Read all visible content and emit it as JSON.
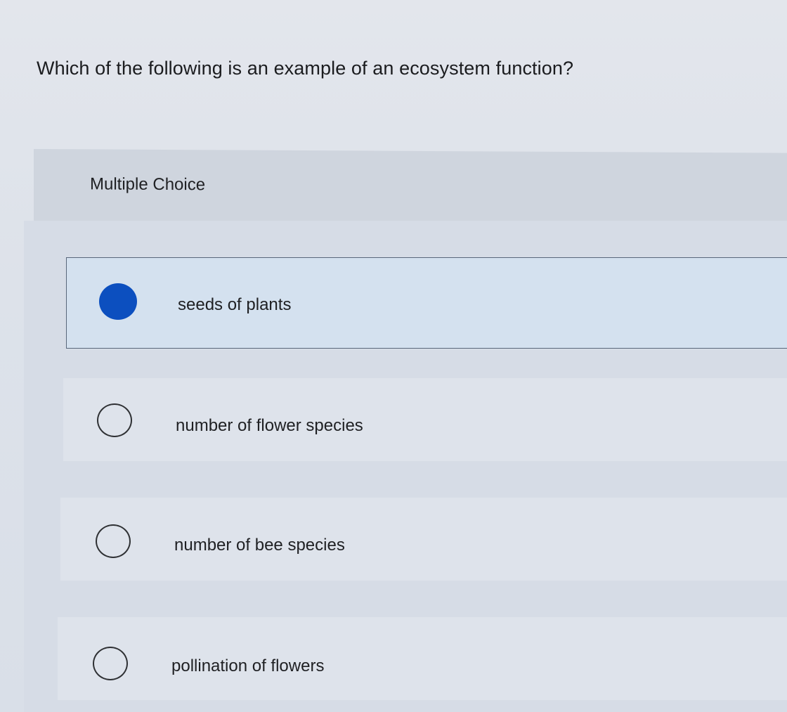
{
  "question": {
    "text": "Which of the following is an example of an ecosystem function?"
  },
  "section": {
    "label": "Multiple Choice"
  },
  "options": [
    {
      "label": "seeds of plants",
      "selected": true
    },
    {
      "label": "number of flower species",
      "selected": false
    },
    {
      "label": "number of bee species",
      "selected": false
    },
    {
      "label": "pollination of flowers",
      "selected": false
    }
  ],
  "colors": {
    "accent": "#0c4fbf",
    "selected_bg": "#d4e1ef",
    "selected_border": "#59677a"
  }
}
